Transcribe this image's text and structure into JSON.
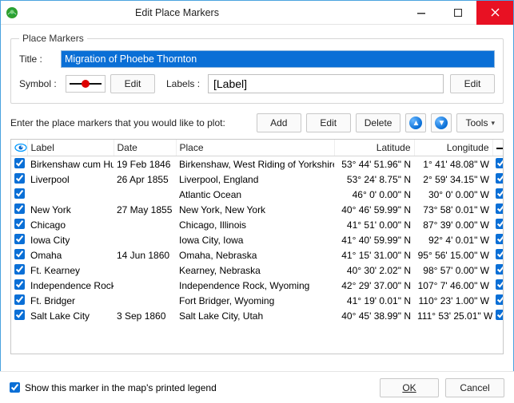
{
  "window": {
    "title": "Edit Place Markers"
  },
  "group": {
    "legend": "Place Markers",
    "title_label": "Title :",
    "title_value": "Migration of Phoebe Thornton",
    "symbol_label": "Symbol :",
    "symbol_edit": "Edit",
    "labels_label": "Labels :",
    "labels_value": "[Label]",
    "labels_edit": "Edit"
  },
  "instructions": "Enter the place markers that you would like to plot:",
  "toolbar": {
    "add": "Add",
    "edit": "Edit",
    "delete": "Delete",
    "tools": "Tools"
  },
  "columns": {
    "label": "Label",
    "date": "Date",
    "place": "Place",
    "lat": "Latitude",
    "lon": "Longitude"
  },
  "rows": [
    {
      "chk": true,
      "label": "Birkenshaw cum Hunsworth",
      "date": "19 Feb 1846",
      "place": "Birkenshaw, West Riding of Yorkshire",
      "lat": "53° 44' 51.96\" N",
      "lon": "1° 41' 48.08\" W",
      "chk2": true
    },
    {
      "chk": true,
      "label": "Liverpool",
      "date": "26 Apr 1855",
      "place": "Liverpool, England",
      "lat": "53° 24' 8.75\" N",
      "lon": "2° 59' 34.15\" W",
      "chk2": true
    },
    {
      "chk": true,
      "label": "",
      "date": "",
      "place": "Atlantic Ocean",
      "lat": "46° 0' 0.00\" N",
      "lon": "30° 0' 0.00\" W",
      "chk2": true
    },
    {
      "chk": true,
      "label": "New York",
      "date": "27 May 1855",
      "place": "New York, New York",
      "lat": "40° 46' 59.99\" N",
      "lon": "73° 58' 0.01\" W",
      "chk2": true
    },
    {
      "chk": true,
      "label": "Chicago",
      "date": "",
      "place": "Chicago, Illinois",
      "lat": "41° 51' 0.00\" N",
      "lon": "87° 39' 0.00\" W",
      "chk2": true
    },
    {
      "chk": true,
      "label": "Iowa City",
      "date": "",
      "place": "Iowa City, Iowa",
      "lat": "41° 40' 59.99\" N",
      "lon": "92° 4' 0.01\" W",
      "chk2": true
    },
    {
      "chk": true,
      "label": "Omaha",
      "date": "14 Jun 1860",
      "place": "Omaha, Nebraska",
      "lat": "41° 15' 31.00\" N",
      "lon": "95° 56' 15.00\" W",
      "chk2": true
    },
    {
      "chk": true,
      "label": "Ft. Kearney",
      "date": "",
      "place": "Kearney, Nebraska",
      "lat": "40° 30' 2.02\" N",
      "lon": "98° 57' 0.00\" W",
      "chk2": true
    },
    {
      "chk": true,
      "label": "Independence Rock",
      "date": "",
      "place": "Independence Rock, Wyoming",
      "lat": "42° 29' 37.00\" N",
      "lon": "107° 7' 46.00\" W",
      "chk2": true
    },
    {
      "chk": true,
      "label": "Ft. Bridger",
      "date": "",
      "place": "Fort Bridger, Wyoming",
      "lat": "41° 19' 0.01\" N",
      "lon": "110° 23' 1.00\" W",
      "chk2": true
    },
    {
      "chk": true,
      "label": "Salt Lake City",
      "date": "3 Sep 1860",
      "place": "Salt Lake City, Utah",
      "lat": "40° 45' 38.99\" N",
      "lon": "111° 53' 25.01\" W",
      "chk2": true
    }
  ],
  "footer": {
    "legend_chk": true,
    "legend_label": "Show this marker in the map's printed legend",
    "ok": "OK",
    "cancel": "Cancel"
  }
}
